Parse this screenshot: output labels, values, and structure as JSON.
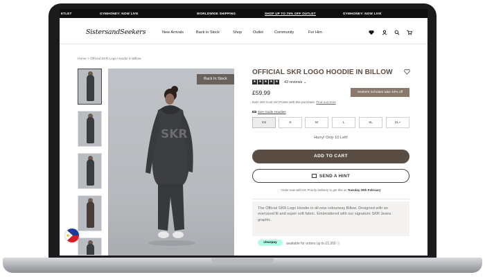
{
  "promo": {
    "items": [
      "ETLET",
      "GYMHONEY: NOW LIVE",
      "WORLDWIDE SHIPPING",
      "SHOP UP TO 75% OFF OUTLET",
      "GYMHONEY: NOW LIVE"
    ]
  },
  "header": {
    "logo": "SistersandSeekers",
    "nav": [
      "New Arrivals",
      "Back in Stock",
      "Shop",
      "Outlet",
      "Community",
      "For Him"
    ],
    "icons": [
      "heart-icon",
      "account-icon",
      "search-icon",
      "cart-icon"
    ]
  },
  "breadcrumb": "Home > Official SKR Logo Hoodie in Billow",
  "gallery": {
    "badge": "Back In Stock",
    "thumbnail_count": 5
  },
  "product": {
    "title": "OFFICIAL SKR LOGO HOODIE IN BILLOW",
    "rating": 5,
    "reviews": "43 reviews",
    "price": "£59.99",
    "scholar_badge": "Seekers Scholars take 10% off",
    "points_text": "Earn 300 Cool Girl Points with this purchase.",
    "points_link": "Find out more",
    "size_guide": "Size Guide Hoodies",
    "sizes": [
      "XS",
      "S",
      "M",
      "L",
      "XL",
      "XL+"
    ],
    "selected_size": "XS",
    "stock_note": "Hurry! Only 10 Left!",
    "add_to_cart": "ADD TO CART",
    "send_hint": "SEND A HINT",
    "delivery_prefix": "Order now with UK Priority Delivery to get this on",
    "delivery_date": "Tuesday 20th February",
    "description": "The Official SKR Logo Hoodie in all new colourway Billow. Designed with an oversized fit and super soft fabric. Embroidered with our signature SKR Jeans graphic.",
    "clearpay_label": "clearpay",
    "clearpay_text": "available for orders up to £1,200 ⓘ"
  },
  "colors": {
    "brand": "#5a4e44",
    "badge": "#8a7a6c",
    "clearpay": "#b2fce4"
  }
}
